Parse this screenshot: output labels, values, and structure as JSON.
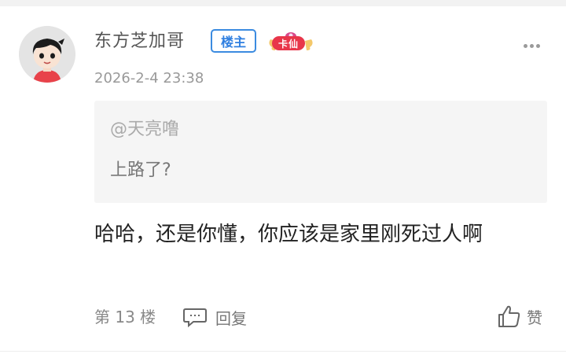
{
  "user": {
    "name": "东方芝加哥",
    "op_badge": "楼主",
    "level_badge": "卡仙",
    "timestamp": "2026-2-4 23:38"
  },
  "quote": {
    "mention": "@天亮噜",
    "text": "上路了?"
  },
  "comment": {
    "text": "哈哈，还是你懂，你应该是家里刚死过人啊"
  },
  "footer": {
    "floor": "第 13 楼",
    "reply_label": "回复",
    "like_label": "赞"
  },
  "icons": {
    "more": "more-dots-icon",
    "reply": "comment-bubble-icon",
    "like": "thumbs-up-icon"
  },
  "colors": {
    "op_badge": "#2f7fe0",
    "level_badge": "#e8364a",
    "quote_bg": "#f5f5f5"
  }
}
